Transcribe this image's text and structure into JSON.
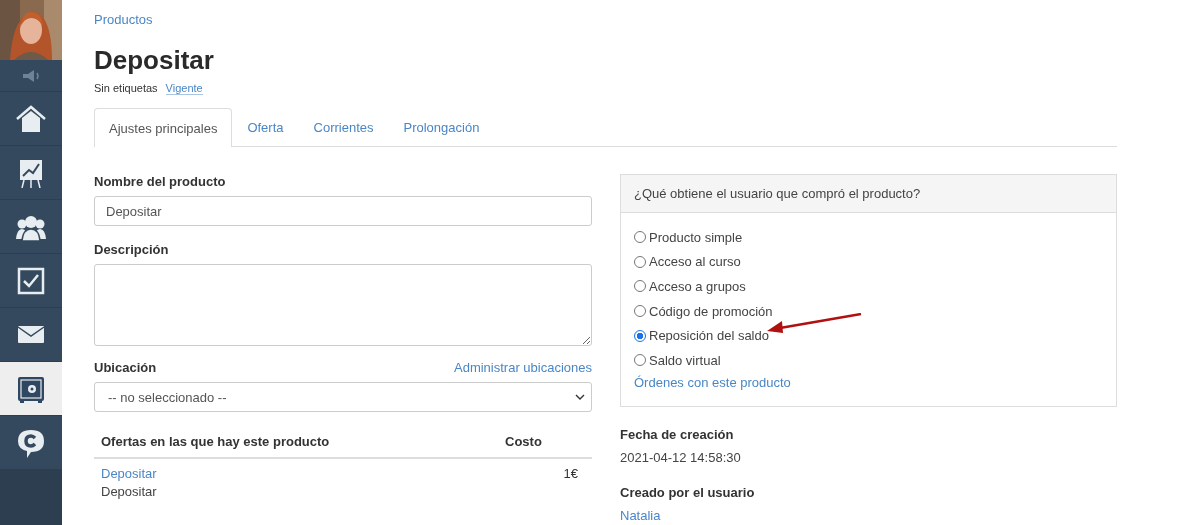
{
  "sidebar": {
    "items": [
      {
        "kind": "sound",
        "selected": false
      },
      {
        "kind": "home",
        "selected": false
      },
      {
        "kind": "chart",
        "selected": false
      },
      {
        "kind": "people",
        "selected": false
      },
      {
        "kind": "check",
        "selected": false
      },
      {
        "kind": "mail",
        "selected": false
      },
      {
        "kind": "safe",
        "selected": true
      },
      {
        "kind": "chat",
        "selected": false
      }
    ]
  },
  "breadcrumb": "Productos",
  "title": "Depositar",
  "tags_label": "Sin etiquetas",
  "status_link": "Vigente",
  "tabs": [
    {
      "label": "Ajustes principales",
      "selected": true
    },
    {
      "label": "Oferta",
      "selected": false
    },
    {
      "label": "Corrientes",
      "selected": false
    },
    {
      "label": "Prolongación",
      "selected": false
    }
  ],
  "form": {
    "name_label": "Nombre del producto",
    "name_value": "Depositar",
    "description_label": "Descripción",
    "location_label": "Ubicación",
    "location_link": "Administrar ubicaciones",
    "location_value": "-- no seleccionado --"
  },
  "offers_table": {
    "columns": [
      "Ofertas en las que hay este producto",
      "Costo"
    ],
    "rows": [
      {
        "link": "Depositar",
        "name": "Depositar",
        "cost": "1€"
      }
    ]
  },
  "panel": {
    "title": "¿Qué obtiene el usuario que compró el producto?",
    "options": [
      {
        "label": "Producto simple",
        "selected": false
      },
      {
        "label": "Acceso al curso",
        "selected": false
      },
      {
        "label": "Acceso a grupos",
        "selected": false
      },
      {
        "label": "Código de promoción",
        "selected": false
      },
      {
        "label": "Reposición del saldo",
        "selected": true
      },
      {
        "label": "Saldo virtual",
        "selected": false
      }
    ],
    "link": "Órdenes con este producto"
  },
  "meta": [
    {
      "label": "Fecha de creación",
      "value": "2021-04-12 14:58:30",
      "kind": "text"
    },
    {
      "label": "Creado por el usuario",
      "value": "Natalia",
      "kind": "link"
    }
  ]
}
